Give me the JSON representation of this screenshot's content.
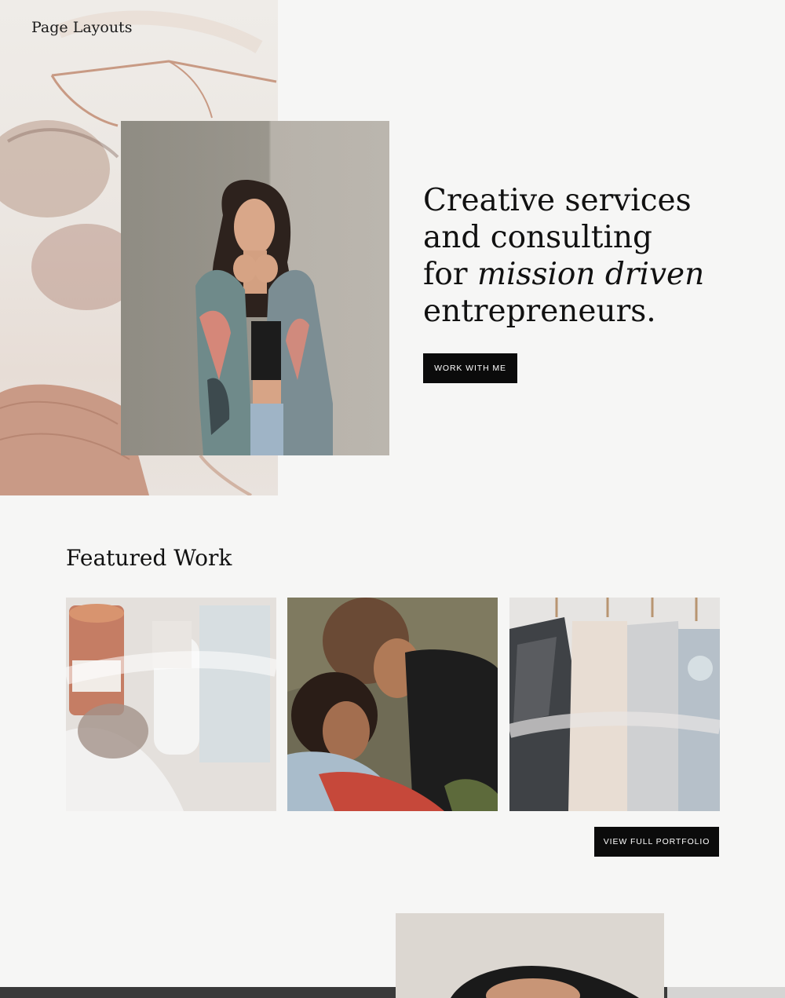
{
  "site": {
    "title": "Page Layouts"
  },
  "hero": {
    "heading_line1": "Creative services",
    "heading_line2": "and consulting",
    "heading_line3_prefix": "for ",
    "heading_line3_emphasis": "mission driven",
    "heading_line4": "entrepreneurs.",
    "button_label": "WORK WITH ME"
  },
  "featured": {
    "title": "Featured Work",
    "button_label": "VIEW FULL PORTFOLIO"
  },
  "colors": {
    "background": "#f6f6f5",
    "button": "#0b0b0b",
    "button_text": "#ffffff",
    "text": "#111111",
    "footer_bar": "#3a3a3a"
  }
}
